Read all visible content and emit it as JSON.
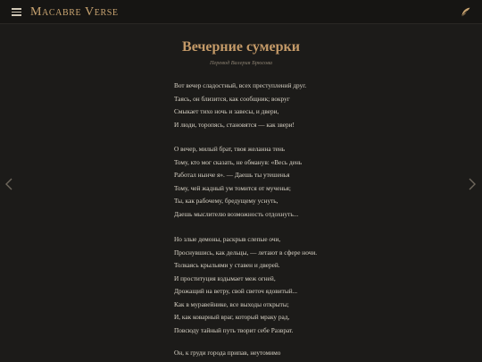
{
  "header": {
    "brand": "Macabre Verse",
    "menu_icon": "hamburger-menu-icon",
    "action_icon": "feather-quill-icon"
  },
  "colors": {
    "background": "#1c1b19",
    "topbar": "#161513",
    "accent": "#c49a68",
    "text": "#d9d3c6",
    "muted": "#8c8272"
  },
  "navigation": {
    "prev_icon": "chevron-left-icon",
    "next_icon": "chevron-right-icon"
  },
  "poem": {
    "title": "Вечерние сумерки",
    "translator": "Перевод Валерия Брюсова",
    "stanzas": [
      [
        "Вот вечер сладостный, всех преступлений друг.",
        "Таясь, он близится, как сообщник; вокруг",
        "Смыкает тихо ночь и завесы, и двери,",
        "И люди, торопясь, становятся — как звери!"
      ],
      [
        "О вечер, милый брат, твоя желанна тень",
        "Тому, кто мог сказать, не обманув: «Весь день",
        "Работал нынче я». — Даешь ты утешенья",
        "Тому, чей жадный ум томится от мученья;",
        "Ты, как рабочему, бредущему уснуть,",
        "Даешь мыслителю возможность отдохнуть..."
      ],
      [
        "Но злые демоны, раскрыв слепые очи,",
        "Проснувшись, как дельцы, — летают в сфере ночи.",
        "Толкаясь крыльями у ставен и дверей.",
        "И проституция вздымает меж огней,",
        "Дрожащий на ветру, свой светоч ядовитый...",
        "Как в муравейнике, все выходы открыты;",
        "И, как коварный враг, который мраку рад,",
        "Повсюду тайный путь творит себе Разврат."
      ],
      [
        "Он, к груди города припав, неутомимо"
      ]
    ]
  }
}
